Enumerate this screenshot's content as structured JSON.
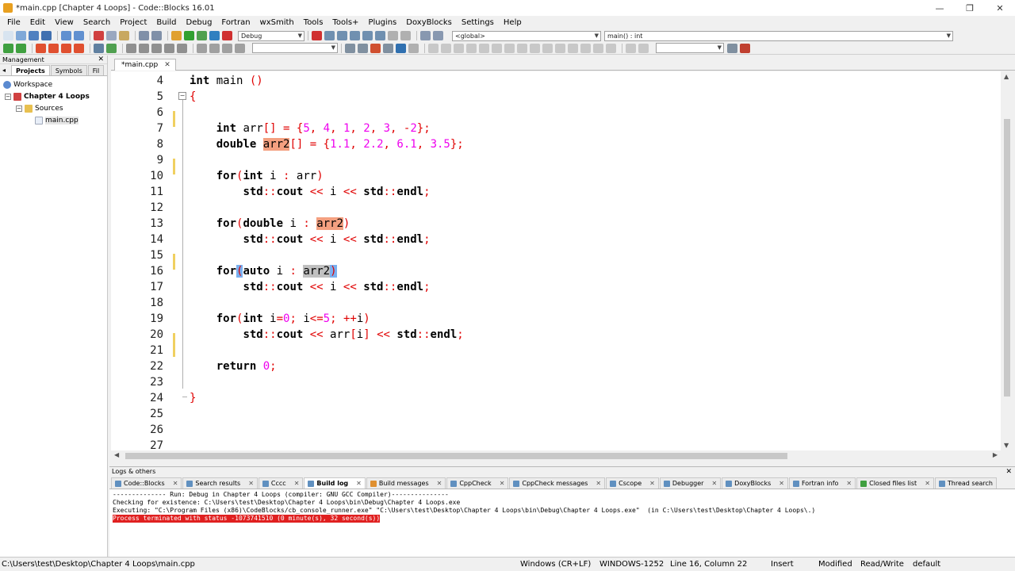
{
  "window": {
    "title": "*main.cpp [Chapter 4 Loops] - Code::Blocks 16.01",
    "controls": [
      "—",
      "❐",
      "✕"
    ]
  },
  "menu": [
    "File",
    "Edit",
    "View",
    "Search",
    "Project",
    "Build",
    "Debug",
    "Fortran",
    "wxSmith",
    "Tools",
    "Tools+",
    "Plugins",
    "DoxyBlocks",
    "Settings",
    "Help"
  ],
  "toolbar": {
    "build_target": "Debug",
    "scope": "<global>",
    "function": "main() : int"
  },
  "management": {
    "title": "Management",
    "close": "✕",
    "tabs": [
      "Projects",
      "Symbols",
      "Fil"
    ],
    "tree": {
      "workspace": "Workspace",
      "project": "Chapter 4 Loops",
      "folder": "Sources",
      "file": "main.cpp"
    }
  },
  "editor": {
    "tab": "*main.cpp",
    "tab_close": "✕",
    "fold_marker": "−",
    "line_numbers": [
      "4",
      "5",
      "6",
      "7",
      "8",
      "9",
      "10",
      "11",
      "12",
      "13",
      "14",
      "15",
      "16",
      "17",
      "18",
      "19",
      "20",
      "21",
      "22",
      "23",
      "24",
      "25",
      "26",
      "27"
    ]
  },
  "logs": {
    "title": "Logs & others",
    "close": "✕",
    "tabs": [
      "Code::Blocks",
      "Search results",
      "Cccc",
      "Build log",
      "Build messages",
      "CppCheck",
      "CppCheck messages",
      "Cscope",
      "Debugger",
      "DoxyBlocks",
      "Fortran info",
      "Closed files list",
      "Thread search"
    ],
    "active_tab": "Build log",
    "lines": [
      "-------------- Run: Debug in Chapter 4 Loops (compiler: GNU GCC Compiler)---------------",
      "Checking for existence: C:\\Users\\test\\Desktop\\Chapter 4 Loops\\bin\\Debug\\Chapter 4 Loops.exe",
      "Executing: \"C:\\Program Files (x86)\\CodeBlocks/cb_console_runner.exe\" \"C:\\Users\\test\\Desktop\\Chapter 4 Loops\\bin\\Debug\\Chapter 4 Loops.exe\"  (in C:\\Users\\test\\Desktop\\Chapter 4 Loops\\.)"
    ],
    "error_line": "Process terminated with status -1073741510 (0 minute(s), 32 second(s))"
  },
  "status": {
    "file": "C:\\Users\\test\\Desktop\\Chapter 4 Loops\\main.cpp",
    "eol": "Windows (CR+LF)",
    "encoding": "WINDOWS-1252",
    "position": "Line 16, Column 22",
    "mode": "Insert",
    "modified": "Modified",
    "access": "Read/Write",
    "profile": "default"
  },
  "colors": {
    "keyword": "#000000",
    "number": "#ee00ee",
    "operator": "#e00000",
    "highlight": "#f4a080",
    "selection": "#c0c0c0",
    "error_bg": "#e02020"
  }
}
